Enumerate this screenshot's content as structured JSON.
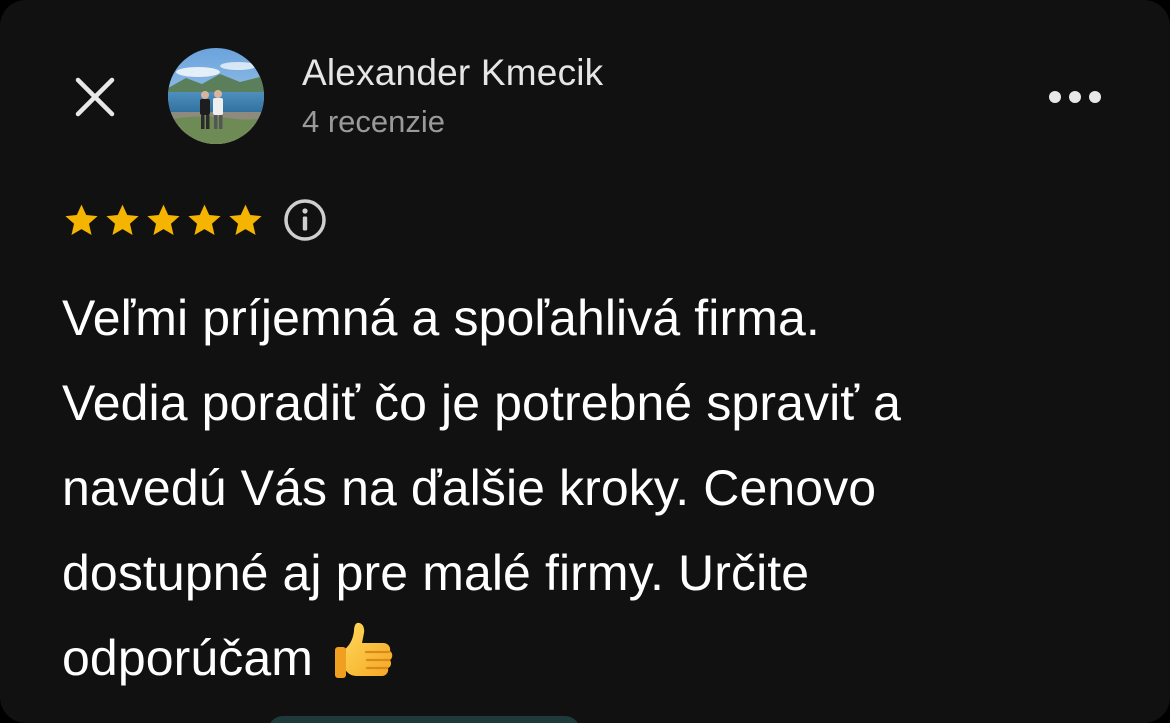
{
  "reviewer": {
    "name": "Alexander Kmecik",
    "review_count": "4 recenzie"
  },
  "rating": {
    "stars": 5,
    "max": 5
  },
  "review": {
    "lines": [
      "Veľmi príjemná a spoľahlivá firma.",
      "Vedia poradiť čo je potrebné spraviť a",
      "navedú Vás na ďalšie kroky. Cenovo",
      "dostupné aj pre malé firmy. Určite",
      "odporúčam"
    ],
    "emoji": "thumbs-up"
  },
  "icons": {
    "close": "close-icon",
    "more": "more-horizontal-icon",
    "info": "info-icon",
    "star": "star-icon"
  },
  "colors": {
    "background": "#111111",
    "star": "#f4b400",
    "text": "#ffffff",
    "secondary_text": "#9a9a9a"
  }
}
